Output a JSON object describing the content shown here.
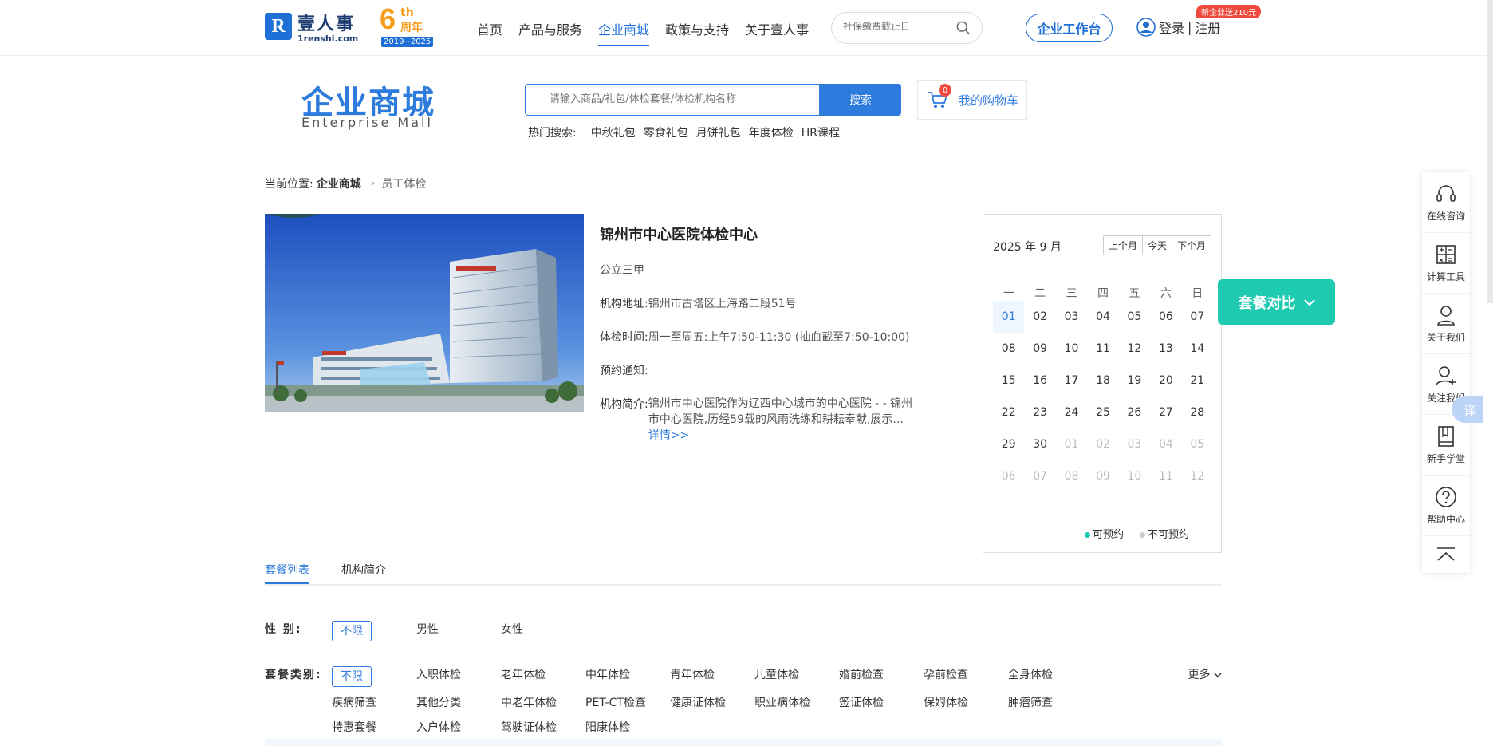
{
  "header": {
    "logo_cn": "壹人事",
    "logo_en": "1renshi.com",
    "anniv_num": "6",
    "anniv_th": "th",
    "anniv_label": "周年",
    "anniv_years": "2019~2025",
    "nav": [
      "首页",
      "产品与服务",
      "企业商城",
      "政策与支持",
      "关于壹人事"
    ],
    "nav_active": "企业商城",
    "search_placeholder": "社保缴费截止日",
    "workbench": "企业工作台",
    "login": "登录",
    "register": "注册",
    "login_sep": "|",
    "promo": "新企业送210元"
  },
  "mall": {
    "title": "企业商城",
    "subtitle": "Enterprise Mall",
    "search_placeholder": "请输入商品/礼包/体检套餐/体检机构名称",
    "search_button": "搜索",
    "cart_label": "我的购物车",
    "cart_count": "0",
    "hot_label": "热门搜索:",
    "hot_keywords": [
      "中秋礼包",
      "零食礼包",
      "月饼礼包",
      "年度体检",
      "HR课程"
    ]
  },
  "breadcrumb": {
    "prefix": "当前位置:",
    "level1": "企业商城",
    "level2": "员工体检"
  },
  "institution": {
    "name": "锦州市中心医院体检中心",
    "grade": "公立三甲",
    "address_label": "机构地址:",
    "address": "锦州市古塔区上海路二段51号",
    "hours_label": "体检时间:",
    "hours": "周一至周五:上午7:50-11:30 (抽血截至7:50-10:00)",
    "notice_label": "预约通知:",
    "notice": "",
    "intro_label": "机构简介:",
    "intro": "锦州市中心医院作为辽西中心城市的中心医院 - - 锦州市中心医院,历经59载的风雨洗练和耕耘奉献,展示...",
    "more": "详情>>"
  },
  "calendar": {
    "month_label": "2025 年 9 月",
    "prev": "上个月",
    "today": "今天",
    "next": "下个月",
    "weekdays": [
      "一",
      "二",
      "三",
      "四",
      "五",
      "六",
      "日"
    ],
    "days": [
      {
        "d": "01",
        "state": "selected"
      },
      {
        "d": "02",
        "state": "normal"
      },
      {
        "d": "03",
        "state": "normal"
      },
      {
        "d": "04",
        "state": "normal"
      },
      {
        "d": "05",
        "state": "normal"
      },
      {
        "d": "06",
        "state": "normal"
      },
      {
        "d": "07",
        "state": "normal"
      },
      {
        "d": "08",
        "state": "normal"
      },
      {
        "d": "09",
        "state": "normal"
      },
      {
        "d": "10",
        "state": "normal"
      },
      {
        "d": "11",
        "state": "normal"
      },
      {
        "d": "12",
        "state": "normal"
      },
      {
        "d": "13",
        "state": "normal"
      },
      {
        "d": "14",
        "state": "normal"
      },
      {
        "d": "15",
        "state": "normal"
      },
      {
        "d": "16",
        "state": "normal"
      },
      {
        "d": "17",
        "state": "normal"
      },
      {
        "d": "18",
        "state": "normal"
      },
      {
        "d": "19",
        "state": "normal"
      },
      {
        "d": "20",
        "state": "normal"
      },
      {
        "d": "21",
        "state": "normal"
      },
      {
        "d": "22",
        "state": "normal"
      },
      {
        "d": "23",
        "state": "normal"
      },
      {
        "d": "24",
        "state": "normal"
      },
      {
        "d": "25",
        "state": "normal"
      },
      {
        "d": "26",
        "state": "normal"
      },
      {
        "d": "27",
        "state": "normal"
      },
      {
        "d": "28",
        "state": "normal"
      },
      {
        "d": "29",
        "state": "normal"
      },
      {
        "d": "30",
        "state": "normal"
      },
      {
        "d": "01",
        "state": "dim"
      },
      {
        "d": "02",
        "state": "dim"
      },
      {
        "d": "03",
        "state": "dim"
      },
      {
        "d": "04",
        "state": "dim"
      },
      {
        "d": "05",
        "state": "dim"
      },
      {
        "d": "06",
        "state": "dim"
      },
      {
        "d": "07",
        "state": "dim"
      },
      {
        "d": "08",
        "state": "dim"
      },
      {
        "d": "09",
        "state": "dim"
      },
      {
        "d": "10",
        "state": "dim"
      },
      {
        "d": "11",
        "state": "dim"
      },
      {
        "d": "12",
        "state": "dim"
      }
    ],
    "legend_available": "可预约",
    "legend_unavailable": "不可预约",
    "color_available": "#1ecbb0",
    "color_unavailable": "#cccccc"
  },
  "compare_button": "套餐对比",
  "tabs": [
    "套餐列表",
    "机构简介"
  ],
  "tab_active": "套餐列表",
  "filters": {
    "gender_label": "性 别:",
    "gender_options": [
      "不限",
      "男性",
      "女性"
    ],
    "category_label": "套餐类别:",
    "category_options": [
      "不限",
      "入职体检",
      "老年体检",
      "中年体检",
      "青年体检",
      "儿童体检",
      "婚前检查",
      "孕前检查",
      "全身体检",
      "疾病筛查",
      "其他分类",
      "中老年体检",
      "PET-CT检查",
      "健康证体检",
      "职业病体检",
      "签证体检",
      "保姆体检",
      "肿瘤筛查",
      "特惠套餐",
      "入户体检",
      "驾驶证体检",
      "阳康体检"
    ],
    "more": "更多"
  },
  "side_toolbar": [
    "在线咨询",
    "计算工具",
    "关于我们",
    "关注我们",
    "新手学堂",
    "帮助中心"
  ],
  "translate": "译",
  "colors": {
    "brand": "#2e7bde",
    "accent": "#1ecbb0",
    "promo": "#f04a3e"
  }
}
